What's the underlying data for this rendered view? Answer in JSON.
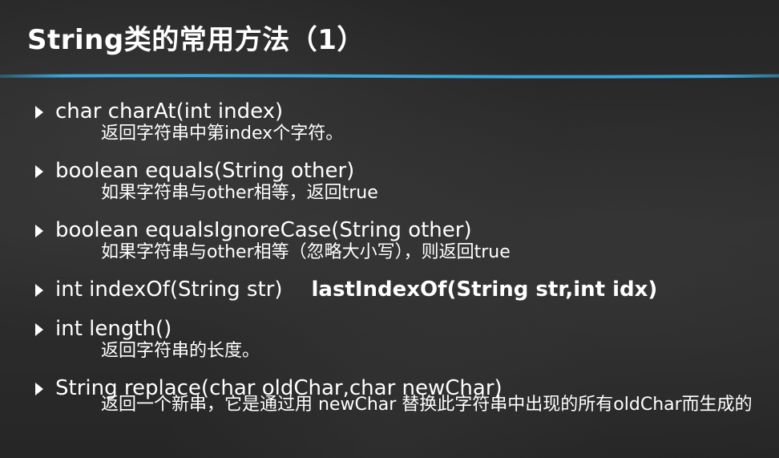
{
  "title": "String类的常用方法（1）",
  "colors": {
    "background": "#2b2b2b",
    "text": "#ffffff",
    "accent_rule": "#3aa5d8"
  },
  "items": [
    {
      "signature": "char charAt(int index)",
      "description": "返回字符串中第index个字符。"
    },
    {
      "signature": "boolean equals(String other)",
      "description": "如果字符串与other相等，返回true"
    },
    {
      "signature": "boolean equalsIgnoreCase(String other)",
      "description": "如果字符串与other相等（忽略大小写），则返回true"
    },
    {
      "signature": "int indexOf(String str)",
      "signature_bold": "lastIndexOf(String str,int idx)"
    },
    {
      "signature": "int length()",
      "description": "返回字符串的长度。"
    },
    {
      "signature": "String replace(char oldChar,char newChar)",
      "description": "返回一个新串，它是通过用 newChar 替换此字符串中出现的所有oldChar而生成的"
    }
  ]
}
